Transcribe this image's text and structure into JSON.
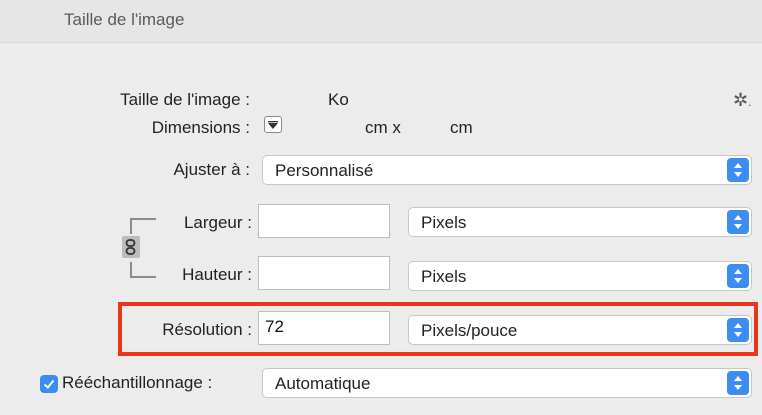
{
  "header": {
    "title": "Taille de l'image"
  },
  "image_size": {
    "label": "Taille de l'image :",
    "unit": "Ko"
  },
  "dimensions": {
    "label": "Dimensions :",
    "unit_x": "cm x",
    "unit_y": "cm"
  },
  "fit_to": {
    "label": "Ajuster à :",
    "value": "Personnalisé"
  },
  "width": {
    "label": "Largeur :",
    "value": "",
    "unit": "Pixels"
  },
  "height": {
    "label": "Hauteur :",
    "value": "",
    "unit": "Pixels"
  },
  "resolution": {
    "label": "Résolution :",
    "value": "72",
    "unit": "Pixels/pouce"
  },
  "resample": {
    "label": "Rééchantillonnage :",
    "checked": true,
    "value": "Automatique"
  },
  "colors": {
    "accent": "#3b8df1",
    "highlight": "#e8361f"
  },
  "icons": [
    "gear-icon",
    "dropdown-triangle-icon",
    "chain-link-icon",
    "checkmark-icon",
    "select-arrows-icon"
  ]
}
